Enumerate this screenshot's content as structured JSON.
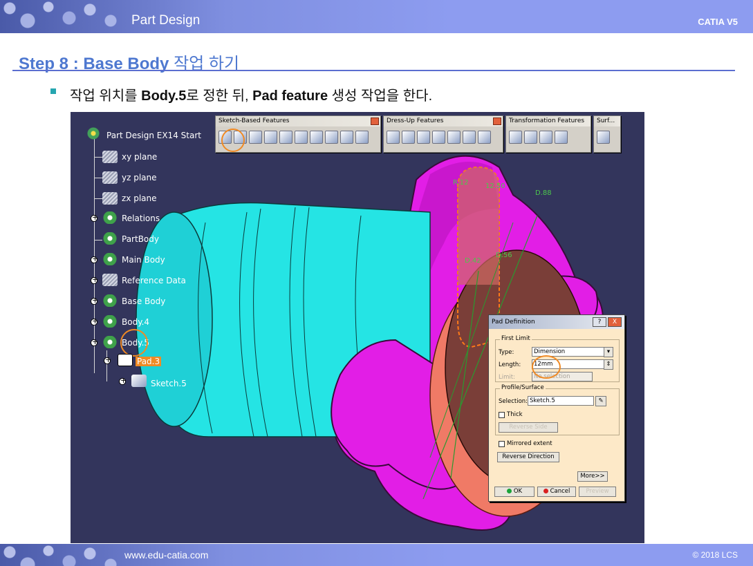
{
  "header": {
    "title": "Part Design",
    "brand": "CATIA V5"
  },
  "footer": {
    "url": "www.edu-catia.com",
    "copyright": "© 2018 LCS"
  },
  "slide": {
    "step_bold": "Step 8 : Base Body",
    "step_rest": " 작업 하기",
    "desc": [
      {
        "text": "작업 위치를 ",
        "bold": false
      },
      {
        "text": "Body.5",
        "bold": true
      },
      {
        "text": "로 정한 뒤, ",
        "bold": false
      },
      {
        "text": "Pad feature",
        "bold": true
      },
      {
        "text": " 생성 작업을 한다.",
        "bold": false
      }
    ]
  },
  "colors": {
    "accent": "#4e78d0",
    "viewport": "#33355c",
    "cyan_part": "#25e4e4",
    "magenta_part": "#e21ee6",
    "highlight_ring": "#f08a24"
  },
  "tree": {
    "root": "Part Design EX14 Start",
    "items": [
      "xy plane",
      "yz plane",
      "zx plane",
      "Relations",
      "PartBody",
      "Main Body",
      "Reference Data",
      "Base Body",
      "Body.4",
      "Body.5",
      "Pad.3",
      "Sketch.5"
    ]
  },
  "toolbars": [
    {
      "title": "Sketch-Based Features",
      "icons": [
        "pad-icon",
        "pocket-icon",
        "shaft-icon",
        "groove-icon",
        "hole-icon",
        "rib-icon",
        "slot-icon",
        "stiffener-icon",
        "loft-icon",
        "remove-loft-icon"
      ]
    },
    {
      "title": "Dress-Up Features",
      "icons": [
        "fillet-icon",
        "chamfer-icon",
        "draft-icon",
        "shell-icon",
        "thickness-icon",
        "thread-icon",
        "remove-face-icon"
      ]
    },
    {
      "title": "Transformation Features",
      "icons": [
        "translate-icon",
        "mirror-icon",
        "pattern-icon",
        "scale-icon"
      ]
    },
    {
      "title": "Surf...",
      "icons": [
        "split-icon"
      ]
    }
  ],
  "dim_labels": [
    "R.12",
    "12.50",
    "D.88",
    "D.42",
    "D.56"
  ],
  "pad_dialog": {
    "title": "Pad Definition",
    "help": "?",
    "close": "X",
    "first_limit": {
      "group": "First Limit",
      "type_label": "Type:",
      "type_value": "Dimension",
      "length_label": "Length:",
      "length_value": "12mm",
      "limit_label": "Limit:",
      "limit_value": "No selection"
    },
    "profile": {
      "group": "Profile/Surface",
      "selection_label": "Selection:",
      "selection_value": "Sketch.5",
      "thick": "Thick",
      "reverse_side": "Reverse Side"
    },
    "mirrored": "Mirrored extent",
    "reverse_direction": "Reverse Direction",
    "more": "More>>",
    "ok": "OK",
    "cancel": "Cancel",
    "preview": "Preview"
  }
}
